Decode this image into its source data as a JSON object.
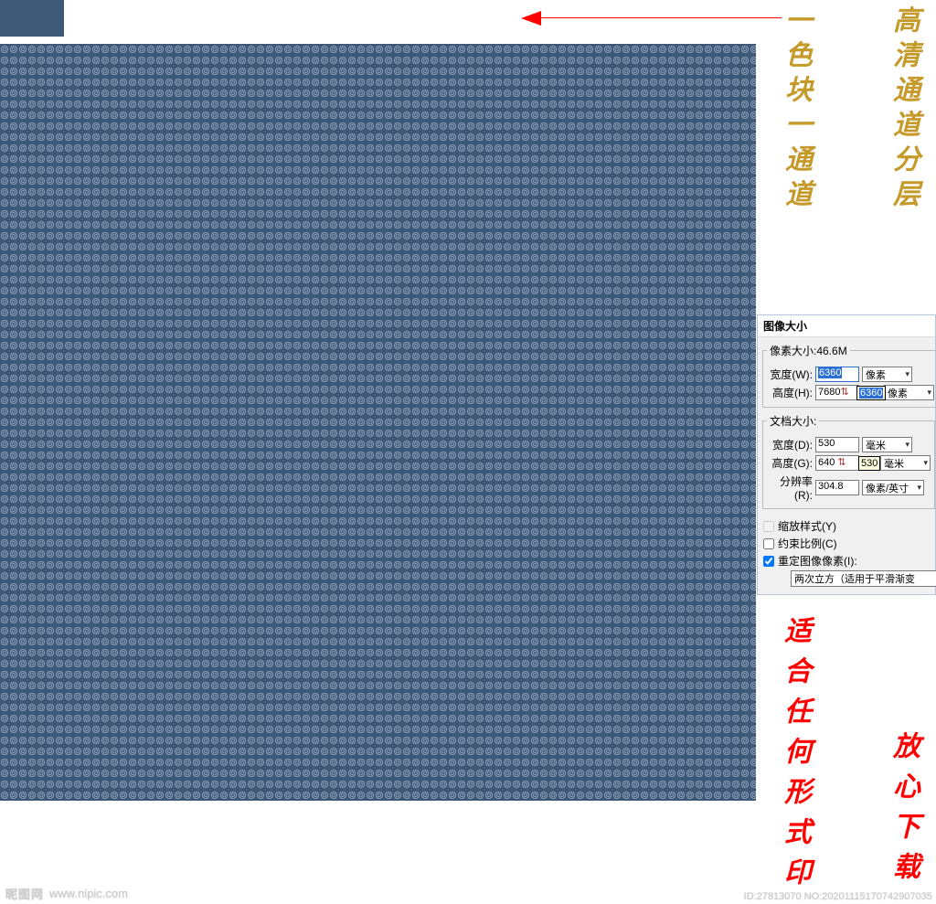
{
  "annotations": {
    "gold_right": "高清通道分层",
    "gold_left": "一色块一通道",
    "red_left": "适合任何形式印",
    "red_right": "放心下载"
  },
  "dialog": {
    "title": "图像大小",
    "pixel_group": {
      "legend": "像素大小:46.6M",
      "width_label": "宽度(W):",
      "width_value": "6360",
      "width_unit": "像素",
      "height_label": "高度(H):",
      "height_value": "7680",
      "height_tooltip": "6360",
      "height_unit": "像素"
    },
    "doc_group": {
      "legend": "文档大小:",
      "width_label": "宽度(D):",
      "width_value": "530",
      "width_unit": "毫米",
      "height_label": "高度(G):",
      "height_value": "640",
      "height_tooltip": "530",
      "height_unit": "毫米",
      "res_label": "分辨率(R):",
      "res_value": "304.8",
      "res_unit": "像素/英寸"
    },
    "checks": {
      "scale_styles": "缩放样式(Y)",
      "constrain": "约束比例(C)",
      "resample": "重定图像像素(I):"
    },
    "bicubic": "两次立方（适用于平滑渐变"
  },
  "watermark": {
    "left_logo": "昵图网",
    "left_url": "www.nipic.com",
    "right_id": "ID:27813070 NO:20201115170742907035"
  }
}
